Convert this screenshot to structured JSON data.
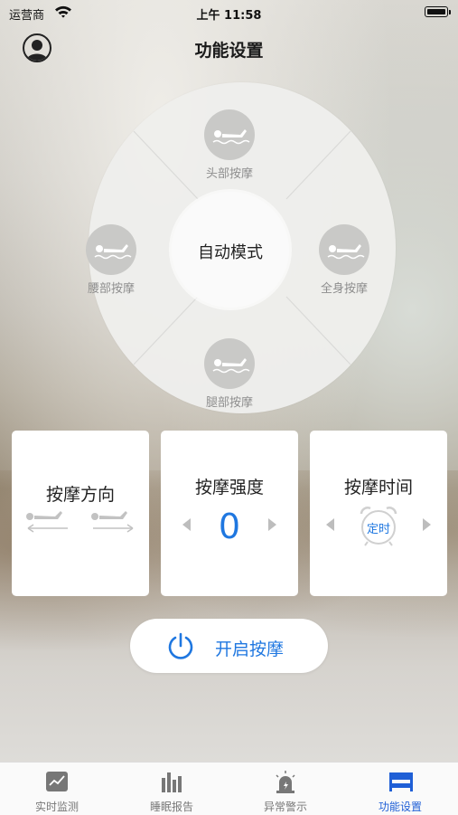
{
  "status_bar": {
    "carrier": "运营商",
    "time": "上午 11:58"
  },
  "header": {
    "title": "功能设置"
  },
  "modes": {
    "center": "自动模式",
    "top": "头部按摩",
    "left": "腰部按摩",
    "right": "全身按摩",
    "bottom": "腿部按摩"
  },
  "cards": {
    "direction": {
      "title": "按摩方向"
    },
    "intensity": {
      "title": "按摩强度",
      "value": "0"
    },
    "timer": {
      "title": "按摩时间",
      "badge": "定时"
    }
  },
  "start_button": {
    "label": "开启按摩"
  },
  "tabs": [
    {
      "label": "实时监测",
      "icon": "chart-icon"
    },
    {
      "label": "睡眠报告",
      "icon": "bar-chart-icon"
    },
    {
      "label": "异常警示",
      "icon": "alarm-light-icon"
    },
    {
      "label": "功能设置",
      "icon": "bed-icon",
      "active": true
    }
  ],
  "colors": {
    "accent": "#1f77e0",
    "tab_active": "#1f5fd6"
  }
}
